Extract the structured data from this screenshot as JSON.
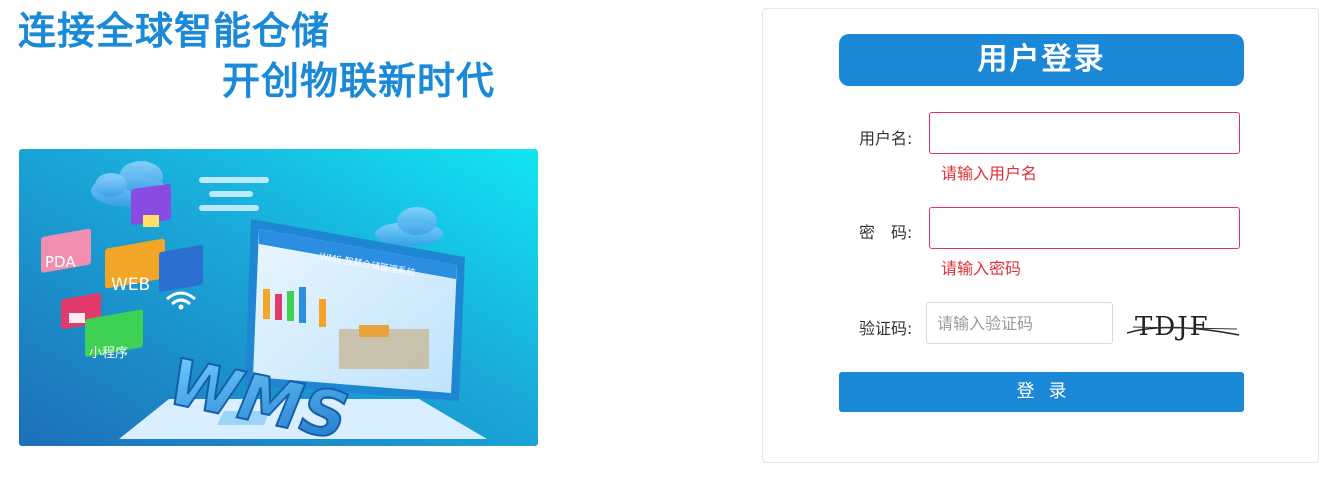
{
  "slogan": {
    "line1": "连接全球智能仓储",
    "line2": "开创物联新时代"
  },
  "hero": {
    "badge_pda": "PDA",
    "badge_web": "WEB",
    "badge_mini": "小程序",
    "laptop_logo": "WMS",
    "screen_title": "WMS 智慧仓储管理系统"
  },
  "login": {
    "title": "用户登录",
    "username_label": "用户名:",
    "username_value": "",
    "username_error": "请输入用户名",
    "password_label": "密　码:",
    "password_value": "",
    "password_error": "请输入密码",
    "captcha_label": "验证码:",
    "captcha_placeholder": "请输入验证码",
    "captcha_image_text": "TDJF",
    "submit_label": "登录"
  },
  "colors": {
    "accent": "#1a88d6",
    "error": "#e0303a",
    "error_border": "#e2336b"
  }
}
